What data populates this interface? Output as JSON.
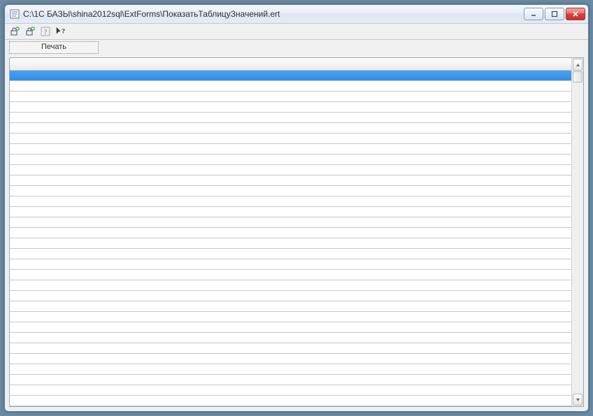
{
  "window": {
    "title": "C:\\1С БАЗЫ\\shina2012sql\\ExtForms\\ПоказатьТаблицуЗначений.ert"
  },
  "toolbar": {
    "print_label": "Печать"
  },
  "grid": {
    "row_count": 32,
    "selected_index": 0
  },
  "icons": {
    "lock_open": "lock-open-icon",
    "lock_closed": "lock-closed-icon",
    "help": "help-icon",
    "whats_this": "whats-this-icon"
  }
}
